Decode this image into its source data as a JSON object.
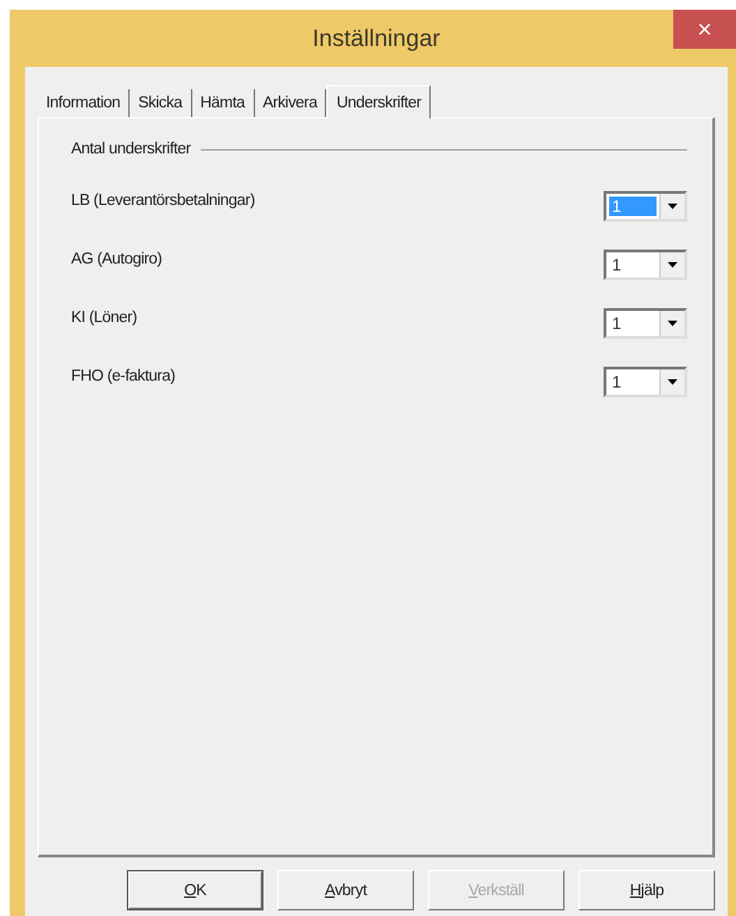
{
  "window": {
    "title": "Inställningar",
    "close": "×"
  },
  "tabs": [
    {
      "label": "Information",
      "selected": false
    },
    {
      "label": "Skicka",
      "selected": false
    },
    {
      "label": "Hämta",
      "selected": false
    },
    {
      "label": "Arkivera",
      "selected": false
    },
    {
      "label": "Underskrifter",
      "selected": true
    }
  ],
  "group": {
    "title": "Antal underskrifter"
  },
  "rows": [
    {
      "label": "LB (Leverantörsbetalningar)",
      "value": "1",
      "focused": true
    },
    {
      "label": "AG (Autogiro)",
      "value": "1",
      "focused": false
    },
    {
      "label": "KI (Löner)",
      "value": "1",
      "focused": false
    },
    {
      "label": "FHO (e-faktura)",
      "value": "1",
      "focused": false
    }
  ],
  "buttons": [
    {
      "label": "OK",
      "default": true,
      "disabled": false,
      "mnemonic": true
    },
    {
      "label": "Avbryt",
      "default": false,
      "disabled": false,
      "mnemonic": true
    },
    {
      "label": "Verkställ",
      "default": false,
      "disabled": true,
      "mnemonic": true
    },
    {
      "label": "Hjälp",
      "default": false,
      "disabled": false,
      "mnemonic": true
    }
  ]
}
